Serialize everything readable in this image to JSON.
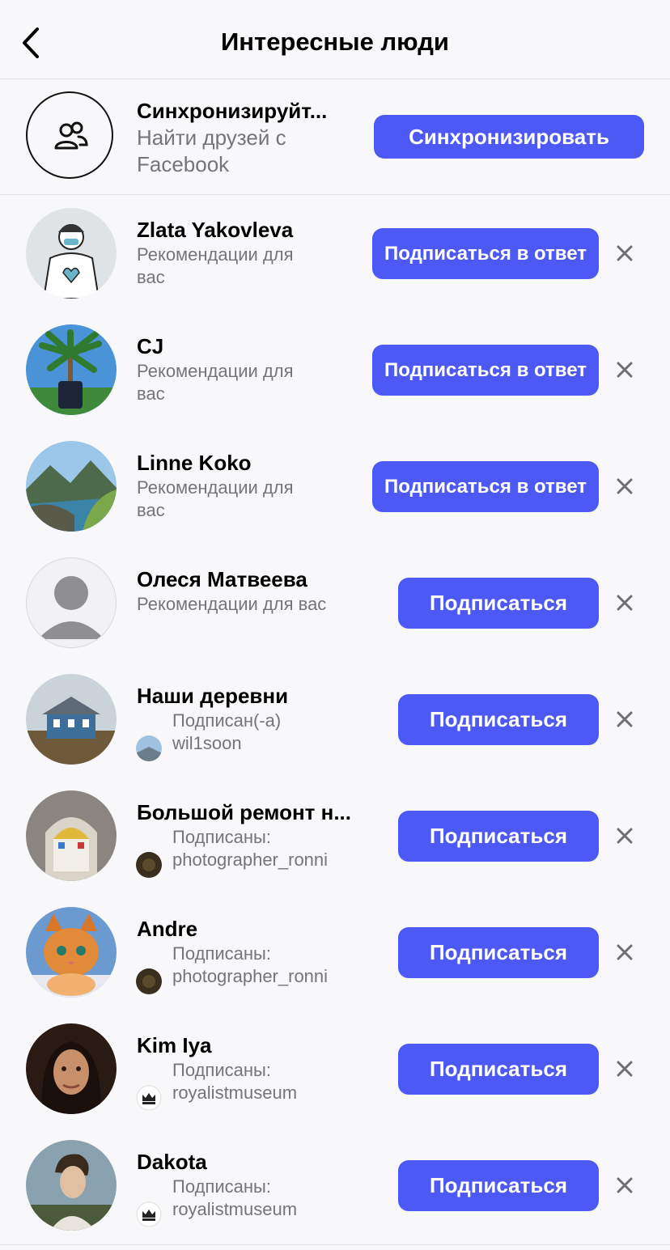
{
  "header": {
    "title": "Интересные люди"
  },
  "sync": {
    "title": "Синхронизируйт...",
    "subtitle": "Найти друзей с Facebook",
    "button": "Синхронизировать"
  },
  "people": [
    {
      "name": "Zlata Yakovleva",
      "subtitle": "Рекомендации для вас",
      "button": "Подписаться в ответ"
    },
    {
      "name": "CJ",
      "subtitle": "Рекомендации для вас",
      "button": "Подписаться в ответ"
    },
    {
      "name": "Linne Koko",
      "subtitle": "Рекомендации для вас",
      "button": "Подписаться в ответ"
    },
    {
      "name": "Олеся Матвеева",
      "subtitle": "Рекомендации для вас",
      "button": "Подписаться"
    },
    {
      "name": "Наши деревни",
      "subtitle": "Подписан(-а) wil1soon",
      "button": "Подписаться"
    },
    {
      "name": "Большой ремонт н...",
      "subtitle": "Подписаны: photographer_ronni",
      "button": "Подписаться"
    },
    {
      "name": "Andre",
      "subtitle": "Подписаны: photographer_ronni",
      "button": "Подписаться"
    },
    {
      "name": "Kim Iya",
      "subtitle": "Подписаны: royalistmuseum",
      "button": "Подписаться"
    },
    {
      "name": "Dakota",
      "subtitle": "Подписаны: royalistmuseum",
      "button": "Подписаться"
    }
  ],
  "colors": {
    "accent": "#4c59f5",
    "secondary_text": "#757579",
    "background": "#f8f8fa"
  }
}
